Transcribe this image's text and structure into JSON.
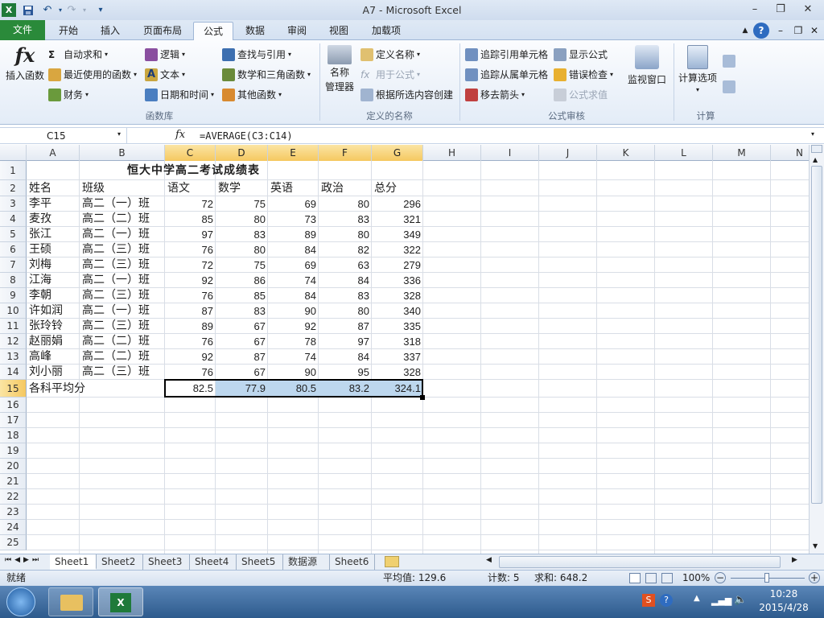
{
  "window": {
    "title": "A7 - Microsoft Excel"
  },
  "tabs": [
    "文件",
    "开始",
    "插入",
    "页面布局",
    "公式",
    "数据",
    "审阅",
    "视图",
    "加载项"
  ],
  "ribbon": {
    "insert_function": "插入函数",
    "autosum": "自动求和",
    "recent": "最近使用的函数",
    "financial": "财务",
    "logical": "逻辑",
    "text": "文本",
    "datetime": "日期和时间",
    "lookup": "查找与引用",
    "math": "数学和三角函数",
    "more": "其他函数",
    "group_library": "函数库",
    "name_manager_1": "名称",
    "name_manager_2": "管理器",
    "define_name": "定义名称",
    "use_in_formula": "用于公式",
    "create_from_sel": "根据所选内容创建",
    "group_names": "定义的名称",
    "trace_prec": "追踪引用单元格",
    "trace_dep": "追踪从属单元格",
    "remove_arrows": "移去箭头",
    "show_formulas": "显示公式",
    "error_check": "错误检查",
    "evaluate": "公式求值",
    "watch": "监视窗口",
    "group_audit": "公式审核",
    "calc_options": "计算选项",
    "group_calc": "计算"
  },
  "formula_bar": {
    "name_box": "C15",
    "fx": "fx",
    "formula": "=AVERAGE(C3:C14)"
  },
  "columns": [
    "A",
    "B",
    "C",
    "D",
    "E",
    "F",
    "G",
    "H",
    "I",
    "J",
    "K",
    "L",
    "M",
    "N"
  ],
  "sheet": {
    "title": "恒大中学高二考试成绩表",
    "headers": [
      "姓名",
      "班级",
      "语文",
      "数学",
      "英语",
      "政治",
      "总分"
    ],
    "rows": [
      [
        "李平",
        "高二（一）班",
        "72",
        "75",
        "69",
        "80",
        "296"
      ],
      [
        "麦孜",
        "高二（二）班",
        "85",
        "80",
        "73",
        "83",
        "321"
      ],
      [
        "张江",
        "高二（一）班",
        "97",
        "83",
        "89",
        "80",
        "349"
      ],
      [
        "王硕",
        "高二（三）班",
        "76",
        "80",
        "84",
        "82",
        "322"
      ],
      [
        "刘梅",
        "高二（三）班",
        "72",
        "75",
        "69",
        "63",
        "279"
      ],
      [
        "江海",
        "高二（一）班",
        "92",
        "86",
        "74",
        "84",
        "336"
      ],
      [
        "李朝",
        "高二（三）班",
        "76",
        "85",
        "84",
        "83",
        "328"
      ],
      [
        "许如润",
        "高二（一）班",
        "87",
        "83",
        "90",
        "80",
        "340"
      ],
      [
        "张玲铃",
        "高二（三）班",
        "89",
        "67",
        "92",
        "87",
        "335"
      ],
      [
        "赵丽娟",
        "高二（二）班",
        "76",
        "67",
        "78",
        "97",
        "318"
      ],
      [
        "高峰",
        "高二（二）班",
        "92",
        "87",
        "74",
        "84",
        "337"
      ],
      [
        "刘小丽",
        "高二（三）班",
        "76",
        "67",
        "90",
        "95",
        "328"
      ]
    ],
    "avg_label": "各科平均分",
    "avg_values": [
      "82.5",
      "77.9",
      "80.5",
      "83.2",
      "324.1"
    ],
    "row_numbers": [
      "1",
      "2",
      "3",
      "4",
      "5",
      "6",
      "7",
      "8",
      "9",
      "10",
      "11",
      "12",
      "13",
      "14",
      "15",
      "16",
      "17",
      "18",
      "19",
      "20",
      "21",
      "22",
      "23",
      "24",
      "25"
    ]
  },
  "sheet_tabs": [
    "Sheet1",
    "Sheet2",
    "Sheet3",
    "Sheet4",
    "Sheet5",
    "数据源",
    "Sheet6"
  ],
  "status": {
    "ready": "就绪",
    "average": "平均值: 129.6",
    "count": "计数: 5",
    "sum": "求和: 648.2",
    "zoom": "100%"
  },
  "taskbar": {
    "time": "10:28",
    "date": "2015/4/28"
  },
  "colors": {
    "file_tab": "#2a8a3a",
    "selection": "#bdd7ee",
    "header_selected": "#f5c860"
  }
}
